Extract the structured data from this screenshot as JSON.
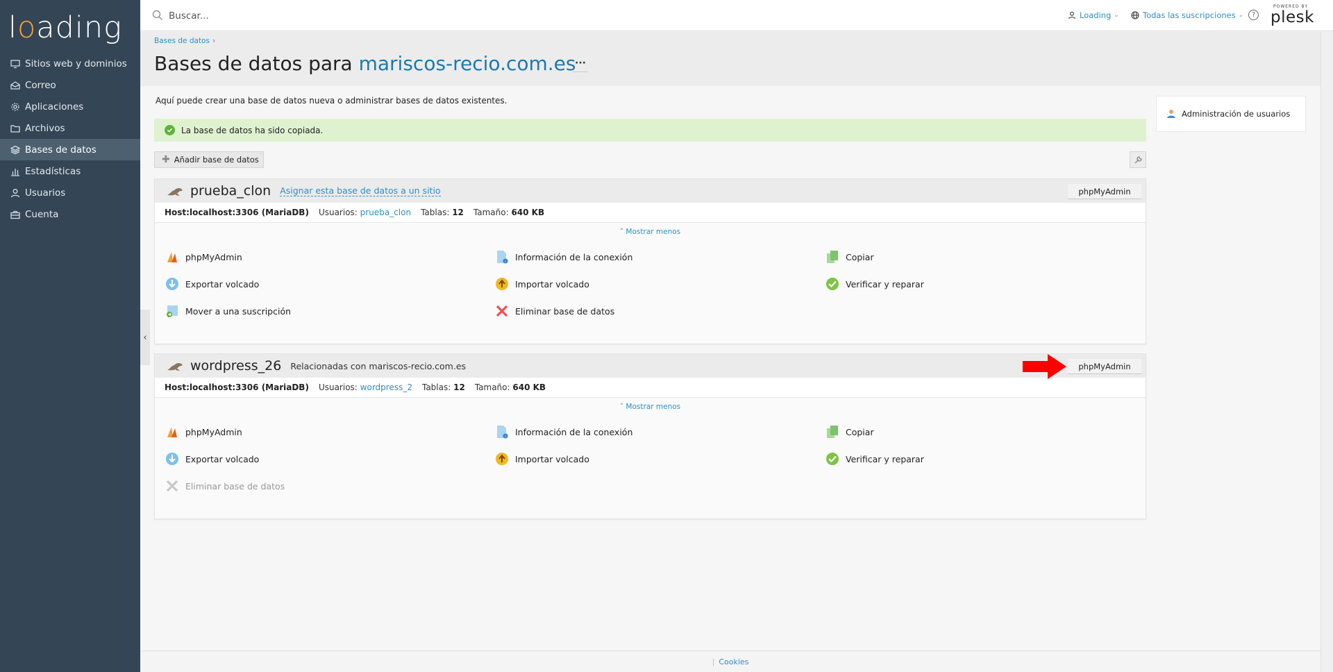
{
  "sidebar": {
    "logo": {
      "pre": "l",
      "o": "o",
      "post": "ading"
    },
    "items": [
      {
        "label": "Sitios web y dominios",
        "icon": "monitor-icon"
      },
      {
        "label": "Correo",
        "icon": "mail-icon"
      },
      {
        "label": "Aplicaciones",
        "icon": "gear-icon"
      },
      {
        "label": "Archivos",
        "icon": "folder-icon"
      },
      {
        "label": "Bases de datos",
        "icon": "layers-icon",
        "active": true
      },
      {
        "label": "Estadísticas",
        "icon": "bar-chart-icon"
      },
      {
        "label": "Usuarios",
        "icon": "user-icon"
      },
      {
        "label": "Cuenta",
        "icon": "briefcase-icon"
      }
    ],
    "collapse_glyph": "‹"
  },
  "topbar": {
    "search_placeholder": "Buscar...",
    "user_label": "Loading",
    "subscriptions_label": "Todas las suscripciones",
    "help_glyph": "?",
    "powered_by": "POWERED BY",
    "brand": "plesk"
  },
  "header": {
    "breadcrumb": "Bases de datos",
    "breadcrumb_sep": "›",
    "title_prefix": "Bases de datos para ",
    "title_domain": "mariscos-recio.com.es",
    "title_menu": "···"
  },
  "main": {
    "intro": "Aquí puede crear una base de datos nueva o administrar bases de datos existentes.",
    "alert": "La base de datos ha sido copiada.",
    "add_button": "Añadir base de datos"
  },
  "databases": [
    {
      "name": "prueba_clon",
      "assign_link": "Asignar esta base de datos a un sitio",
      "related": "",
      "pma_button": "phpMyAdmin",
      "host": "Host:localhost:3306 (MariaDB)",
      "users_label": "Usuarios:",
      "users_value": "prueba_clon",
      "tables_label": "Tablas:",
      "tables_value": "12",
      "size_label": "Tamaño:",
      "size_value": "640 KB",
      "show_less": "˄ Mostrar menos",
      "actions": {
        "phpmyadmin": "phpMyAdmin",
        "connection_info": "Información de la conexión",
        "copy": "Copiar",
        "export": "Exportar volcado",
        "import": "Importar volcado",
        "verify": "Verificar y reparar",
        "move": "Mover a una suscripción",
        "delete": "Eliminar base de datos"
      }
    },
    {
      "name": "wordpress_26",
      "assign_link": "",
      "related": "Relacionadas con mariscos-recio.com.es",
      "pma_button": "phpMyAdmin",
      "host": "Host:localhost:3306 (MariaDB)",
      "users_label": "Usuarios:",
      "users_value": "wordpress_2",
      "tables_label": "Tablas:",
      "tables_value": "12",
      "size_label": "Tamaño:",
      "size_value": "640 KB",
      "show_less": "˄ Mostrar menos",
      "actions": {
        "phpmyadmin": "phpMyAdmin",
        "connection_info": "Información de la conexión",
        "copy": "Copiar",
        "export": "Exportar volcado",
        "import": "Importar volcado",
        "verify": "Verificar y reparar",
        "delete": "Eliminar base de datos"
      }
    }
  ],
  "right_panel": {
    "user_admin": "Administración de usuarios"
  },
  "footer": {
    "cookies": "Cookies"
  },
  "colors": {
    "sidebar": "#344555",
    "link": "#2b8fc5",
    "success_bg": "#dff2cf",
    "arrow": "#ff0000"
  }
}
